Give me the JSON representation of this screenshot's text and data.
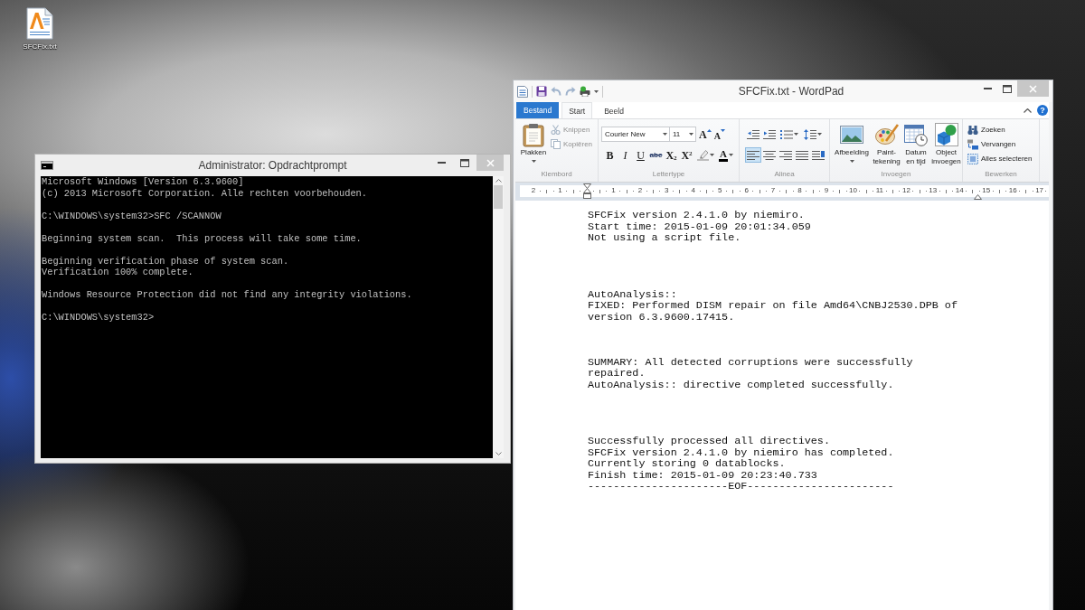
{
  "desktop": {
    "icons": [
      {
        "label": "SFCFix.txt"
      }
    ]
  },
  "console_window": {
    "title": "Administrator: Opdrachtprompt",
    "lines": [
      {
        "kind": "text",
        "text": "Microsoft Windows [Version 6.3.9600]"
      },
      {
        "kind": "text",
        "text": "(c) 2013 Microsoft Corporation. Alle rechten voorbehouden."
      },
      {
        "kind": "blank"
      },
      {
        "kind": "text",
        "text": "C:\\WINDOWS\\system32>SFC /SCANNOW"
      },
      {
        "kind": "blank"
      },
      {
        "kind": "text",
        "text": "Beginning system scan.  This process will take some time."
      },
      {
        "kind": "blank"
      },
      {
        "kind": "text",
        "text": "Beginning verification phase of system scan."
      },
      {
        "kind": "text",
        "text": "Verification 100% complete."
      },
      {
        "kind": "blank"
      },
      {
        "kind": "text",
        "text": "Windows Resource Protection did not find any integrity violations."
      },
      {
        "kind": "blank"
      },
      {
        "kind": "text",
        "text": "C:\\WINDOWS\\system32>"
      }
    ]
  },
  "wordpad_window": {
    "title": "SFCFix.txt - WordPad",
    "file_button": {
      "label": "Bestand"
    },
    "tabs": [
      {
        "label": "Start",
        "selected": true
      },
      {
        "label": "Beeld",
        "selected": false
      }
    ],
    "help_button": {
      "label": "?"
    },
    "ribbon": {
      "groups": [
        {
          "kind": "clipboard",
          "label": "Klembord",
          "paste": {
            "label": "Plakken",
            "dropdown": true
          },
          "commands": [
            {
              "kind": "cut",
              "label": "Knippen",
              "disabled": true
            },
            {
              "kind": "copy",
              "label": "Kopiëren",
              "disabled": true
            }
          ]
        },
        {
          "kind": "font",
          "label": "Lettertype",
          "font_name": "Courier New",
          "font_size": "11",
          "size_buttons": [
            {
              "kind": "grow",
              "label": "A"
            },
            {
              "kind": "shrink",
              "label": "A"
            }
          ],
          "style_buttons": [
            {
              "kind": "bold",
              "label": "B"
            },
            {
              "kind": "italic",
              "label": "I"
            },
            {
              "kind": "underline",
              "label": "U"
            },
            {
              "kind": "strikethrough",
              "label": "abc"
            },
            {
              "kind": "subscript",
              "label": "X$_{2}$"
            },
            {
              "kind": "superscript",
              "label": "X$^{2}$"
            }
          ],
          "color_button": {
            "label": "A"
          }
        },
        {
          "kind": "paragraph",
          "label": "Alinea",
          "alignments": [
            {
              "kind": "left",
              "selected": true
            },
            {
              "kind": "center",
              "selected": false
            },
            {
              "kind": "right",
              "selected": false
            },
            {
              "kind": "justify",
              "selected": false
            }
          ]
        },
        {
          "kind": "insert",
          "label": "Invoegen",
          "commands": [
            {
              "kind": "picture",
              "lines": [
                "Afbeelding"
              ],
              "dropdown": true
            },
            {
              "kind": "paint",
              "lines": [
                "Paint-",
                "tekening"
              ],
              "dropdown": false
            },
            {
              "kind": "datetime",
              "lines": [
                "Datum",
                "en tijd"
              ],
              "dropdown": false
            },
            {
              "kind": "object",
              "lines": [
                "Object",
                "invoegen"
              ],
              "dropdown": false
            }
          ]
        },
        {
          "kind": "editing",
          "label": "Bewerken",
          "commands": [
            {
              "kind": "find",
              "label": "Zoeken"
            },
            {
              "kind": "replace",
              "label": "Vervangen"
            },
            {
              "kind": "select_all",
              "label": "Alles selecteren"
            }
          ]
        }
      ]
    },
    "ruler": {
      "left_numbers": [
        "2",
        "1"
      ],
      "numbers": [
        "1",
        "2",
        "3",
        "4",
        "5",
        "6",
        "7",
        "8",
        "9",
        "10",
        "11",
        "12",
        "13",
        "14",
        "15",
        "16",
        "17"
      ]
    },
    "document": {
      "paragraphs": [
        {
          "kind": "text",
          "text": "SFCFix version 2.4.1.0 by niemiro."
        },
        {
          "kind": "text",
          "text": "Start time: 2015-01-09 20:01:34.059"
        },
        {
          "kind": "text",
          "text": "Not using a script file."
        },
        {
          "kind": "blank"
        },
        {
          "kind": "blank"
        },
        {
          "kind": "blank"
        },
        {
          "kind": "blank"
        },
        {
          "kind": "text",
          "text": "AutoAnalysis::"
        },
        {
          "kind": "text",
          "text": "FIXED: Performed DISM repair on file Amd64\\CNBJ2530.DPB of version 6.3.9600.17415."
        },
        {
          "kind": "blank"
        },
        {
          "kind": "blank"
        },
        {
          "kind": "blank"
        },
        {
          "kind": "text",
          "text": "SUMMARY: All detected corruptions were successfully repaired."
        },
        {
          "kind": "text",
          "text": "AutoAnalysis:: directive completed successfully."
        },
        {
          "kind": "blank"
        },
        {
          "kind": "blank"
        },
        {
          "kind": "blank"
        },
        {
          "kind": "blank"
        },
        {
          "kind": "text",
          "text": "Successfully processed all directives."
        },
        {
          "kind": "text",
          "text": "SFCFix version 2.4.1.0 by niemiro has completed."
        },
        {
          "kind": "text",
          "text": "Currently storing 0 datablocks."
        },
        {
          "kind": "text",
          "text": "Finish time: 2015-01-09 20:23:40.733"
        },
        {
          "kind": "text",
          "text": "----------------------EOF-----------------------"
        }
      ]
    }
  }
}
